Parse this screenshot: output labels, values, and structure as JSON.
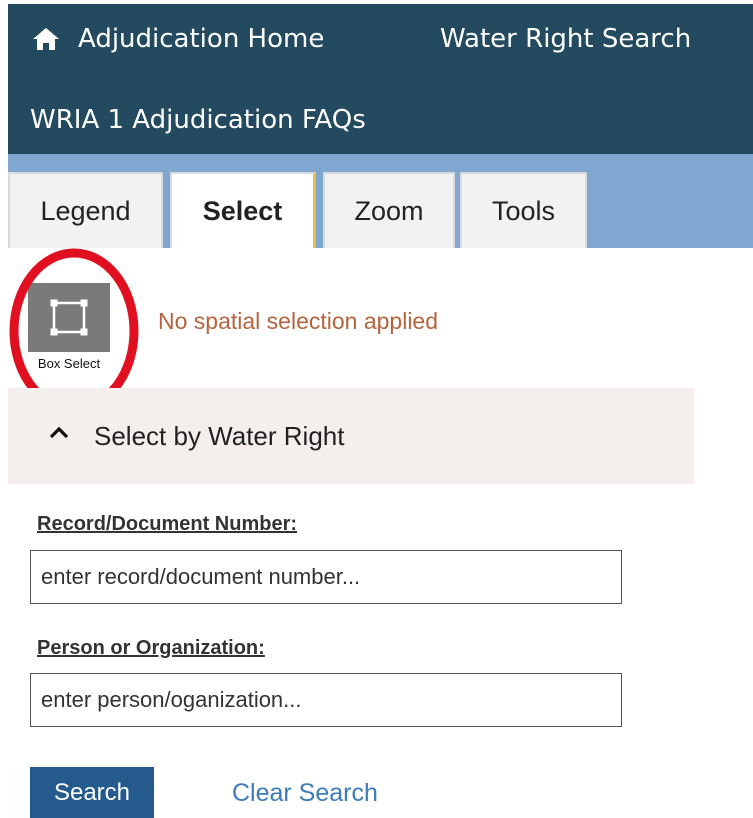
{
  "navbar": {
    "home_label": "Adjudication Home",
    "search_label": "Water Right Search",
    "faq_label": "WRIA 1 Adjudication FAQs",
    "home_icon": "home-icon",
    "background": "#244a5f"
  },
  "tabs": {
    "items": [
      {
        "label": "Legend"
      },
      {
        "label": "Select"
      },
      {
        "label": "Zoom"
      },
      {
        "label": "Tools"
      }
    ],
    "active": "Select",
    "bar_color": "#7fa7cf"
  },
  "box_select": {
    "label": "Box Select",
    "icon": "box-select-icon",
    "highlight_color": "#e01020"
  },
  "selection_status": "No spatial selection applied",
  "accordion": {
    "title": "Select by Water Right",
    "icon": "chevron-up-icon"
  },
  "form": {
    "record_label": "Record/Document Number:",
    "record_placeholder": "enter record/document number...",
    "person_label": "Person or Organization:",
    "person_placeholder": "enter person/oganization...",
    "search_button": "Search",
    "clear_link": "Clear Search"
  }
}
